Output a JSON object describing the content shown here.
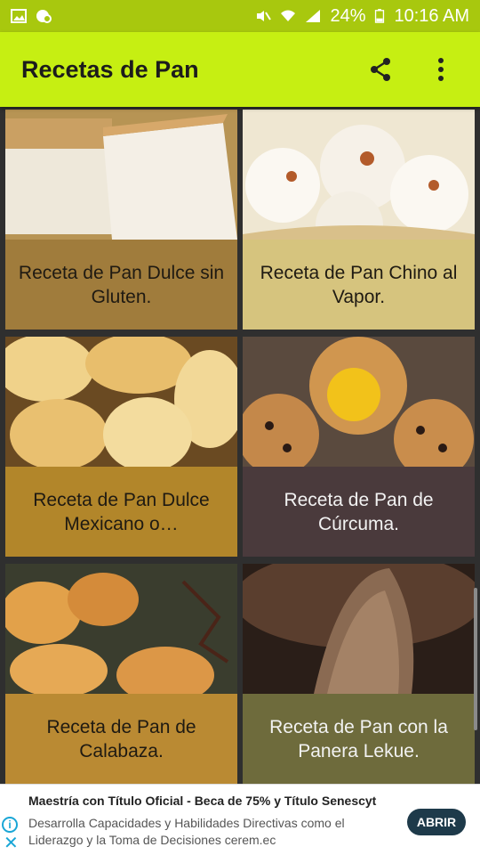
{
  "status": {
    "battery": "24%",
    "time": "10:16 AM"
  },
  "app": {
    "title": "Recetas de Pan"
  },
  "cards": [
    {
      "label": "Receta de Pan Dulce sin Gluten.",
      "bg": "#a07c3c",
      "text_color": "#1f1a12"
    },
    {
      "label": "Receta de Pan Chino al Vapor.",
      "bg": "#d6c47e",
      "text_color": "#1f1a12"
    },
    {
      "label": "Receta de Pan Dulce Mexicano o…",
      "bg": "#b2862a",
      "text_color": "#1f1a12"
    },
    {
      "label": "Receta de Pan de Cúrcuma.",
      "bg": "#4a3a3c",
      "text_color": "#f2f2f2"
    },
    {
      "label": "Receta de Pan de Calabaza.",
      "bg": "#ba8a33",
      "text_color": "#1f1a12"
    },
    {
      "label": "Receta de Pan con la Panera Lekue.",
      "bg": "#6e6b3c",
      "text_color": "#f2f2f2"
    }
  ],
  "ad": {
    "title": "Maestría con Título Oficial - Beca de 75% y Título Senescyt",
    "body": "Desarrolla Capacidades y Habilidades Directivas como el Liderazgo y la Toma de Decisiones cerem.ec",
    "button": "ABRIR",
    "info_icon": "info-icon",
    "close_icon": "close-icon"
  }
}
